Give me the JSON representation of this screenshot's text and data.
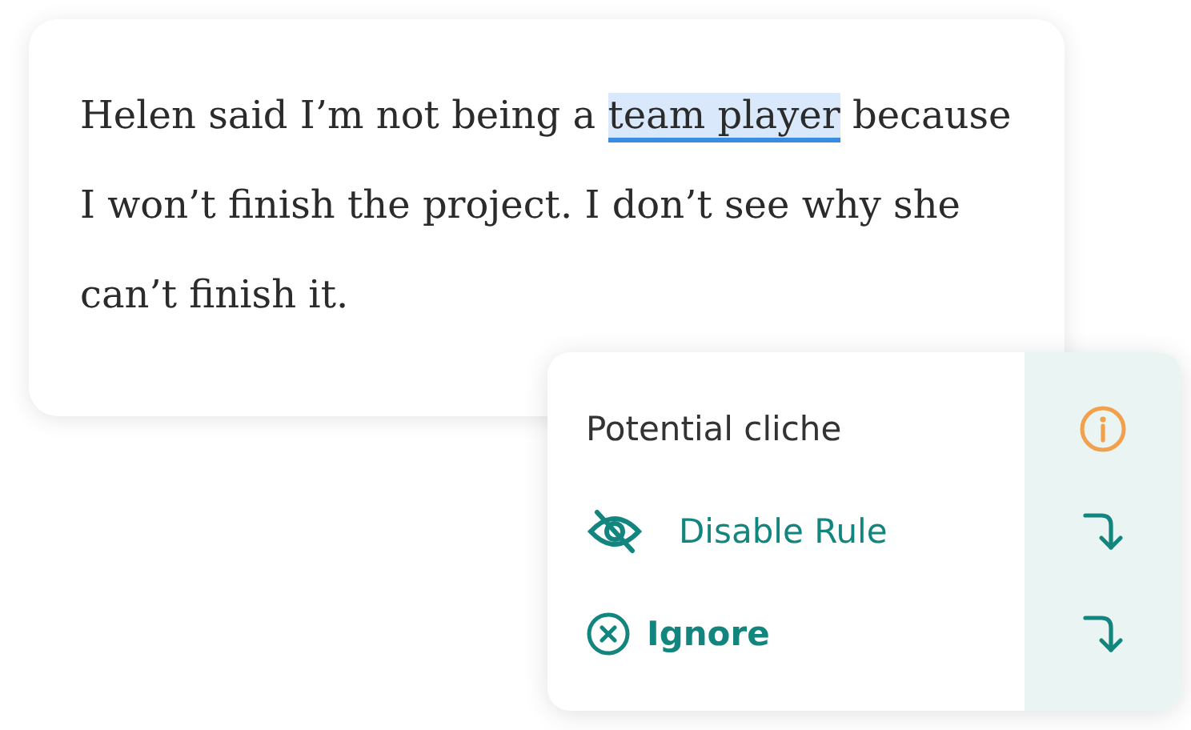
{
  "editor": {
    "text_parts": [
      {
        "text": "Helen said I’m not being a ",
        "highlighted": false
      },
      {
        "text": "team player",
        "highlighted": true
      },
      {
        "text": " because I won’t finish the project. I don’t see why she can’t finish it.",
        "highlighted": false
      }
    ]
  },
  "popup": {
    "title": "Potential cliche",
    "actions": [
      {
        "kind": "disable",
        "label": "Disable Rule"
      },
      {
        "kind": "ignore",
        "label": "Ignore"
      }
    ]
  }
}
